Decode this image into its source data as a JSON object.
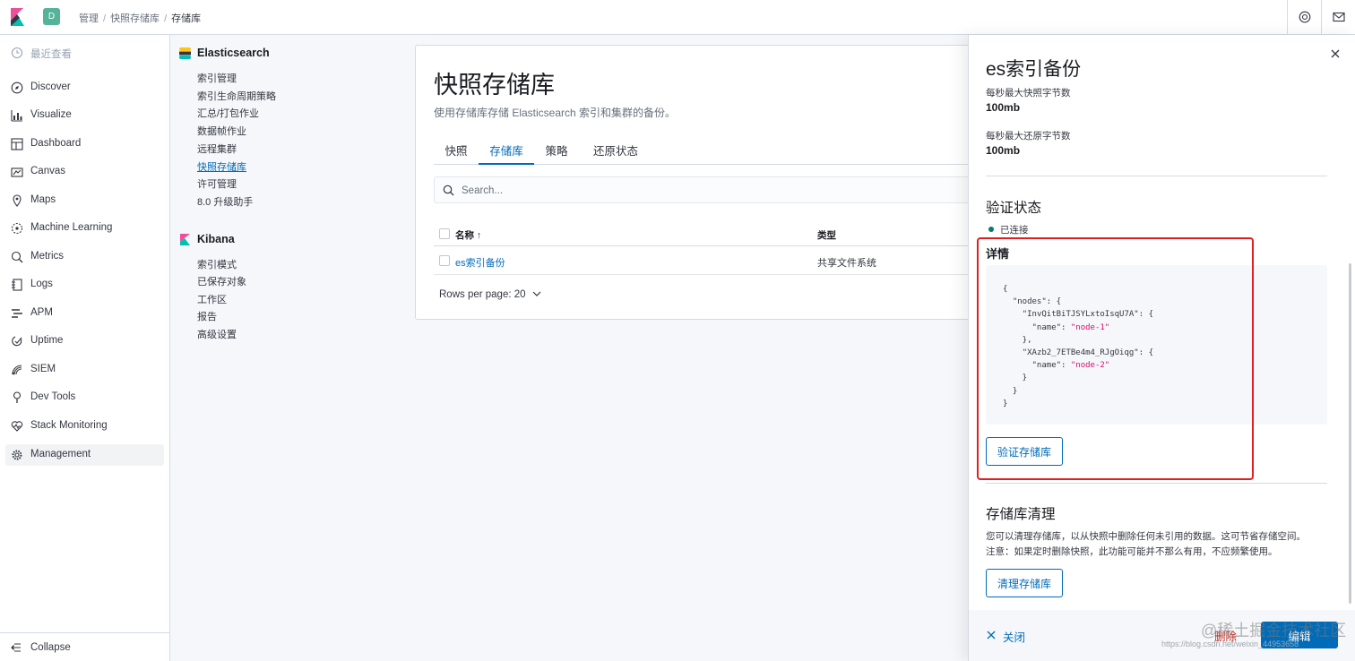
{
  "header": {
    "space_initial": "D",
    "breadcrumbs": [
      "管理",
      "快照存储库",
      "存储库"
    ]
  },
  "nav": {
    "recent": "最近查看",
    "items": [
      "Discover",
      "Visualize",
      "Dashboard",
      "Canvas",
      "Maps",
      "Machine Learning",
      "Metrics",
      "Logs",
      "APM",
      "Uptime",
      "SIEM",
      "Dev Tools",
      "Stack Monitoring",
      "Management"
    ],
    "active": "Management",
    "collapse": "Collapse"
  },
  "mgmt": {
    "elasticsearch": {
      "title": "Elasticsearch",
      "links": [
        "索引管理",
        "索引生命周期策略",
        "汇总/打包作业",
        "数据帧作业",
        "远程集群",
        "快照存储库",
        "许可管理",
        "8.0 升级助手"
      ]
    },
    "kibana": {
      "title": "Kibana",
      "links": [
        "索引模式",
        "已保存对象",
        "工作区",
        "报告",
        "高级设置"
      ]
    }
  },
  "main": {
    "title": "快照存储库",
    "description": "使用存储库存储 Elasticsearch 索引和集群的备份。",
    "tabs": [
      "快照",
      "存储库",
      "策略",
      "还原状态"
    ],
    "active_tab": "存储库",
    "search_placeholder": "Search...",
    "table": {
      "columns": [
        "名称",
        "类型"
      ],
      "sort_arrow": "↑",
      "rows": [
        {
          "name": "es索引备份",
          "type": "共享文件系统"
        }
      ]
    },
    "rows_per_page": "Rows per page: 20"
  },
  "flyout": {
    "title": "es索引备份",
    "max_snapshot_label": "每秒最大快照字节数",
    "max_snapshot_value": "100mb",
    "max_restore_label": "每秒最大还原字节数",
    "max_restore_value": "100mb",
    "verify_title": "验证状态",
    "verify_status": "已连接",
    "details_title": "详情",
    "code": {
      "open": "{",
      "nodes_key": "\"nodes\"",
      "node1_id": "\"InvQitBiTJSYLxtoIsqU7A\"",
      "node1_name_key": "\"name\"",
      "node1_name": "\"node-1\"",
      "node2_id": "\"XAzb2_7ETBe4m4_RJgOiqg\"",
      "node2_name_key": "\"name\"",
      "node2_name": "\"node-2\"",
      "close": "}"
    },
    "verify_button": "验证存储库",
    "cleanup_title": "存储库清理",
    "cleanup_p1": "您可以清理存储库，以从快照中删除任何未引用的数据。这可节省存储空间。",
    "cleanup_p2": "注意：如果定时删除快照，此功能可能并不那么有用，不应频繁使用。",
    "cleanup_button": "清理存储库",
    "close_label": "关闭",
    "delete_label": "删除",
    "edit_label": "编辑"
  },
  "watermark": {
    "line1": "@稀土掘金技术社区",
    "line2": "https://blog.csdn.net/weixin_44953658"
  },
  "colors": {
    "accent": "#006bb8",
    "danger": "#bd271e",
    "success": "#017d73",
    "highlight_box": "#e02020"
  }
}
